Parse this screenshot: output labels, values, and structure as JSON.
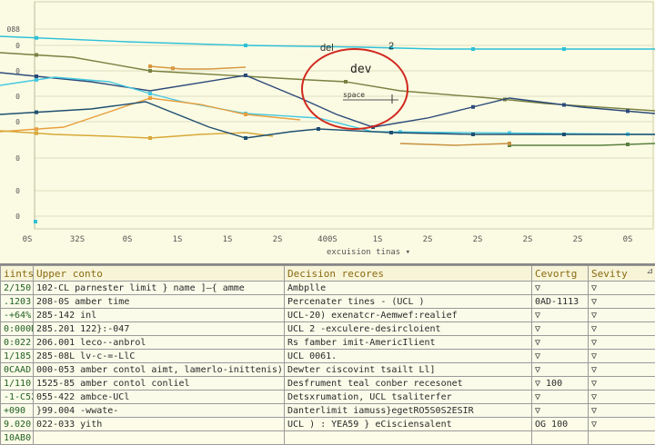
{
  "chart_data": {
    "type": "line",
    "y_tick_labels": [
      "088",
      "0",
      "0",
      "0",
      "0",
      "0",
      "0",
      "0"
    ],
    "y_tick_positions": [
      32,
      50,
      78,
      106,
      134,
      174,
      210,
      238
    ],
    "ylim": [
      0,
      300
    ],
    "x_tick_labels": [
      "0S",
      "32S",
      "0S",
      "1S",
      "1S",
      "2S",
      "400S",
      "1S",
      "2S",
      "2S",
      "2S",
      "2S",
      "0S"
    ],
    "xlabel": "excuision tinas",
    "series": [
      {
        "color": "#2ec0d8",
        "x": [
          0,
          140,
          270,
          400,
          480,
          560,
          620,
          720
        ],
        "y": [
          40,
          46,
          50,
          52,
          54,
          54,
          54,
          54
        ],
        "markers": [
          40,
          270,
          430,
          520,
          620
        ]
      },
      {
        "color": "#7a8040",
        "x": [
          0,
          80,
          165,
          270,
          340,
          380,
          440,
          540,
          600,
          720
        ],
        "y": [
          58,
          63,
          78,
          84,
          88,
          90,
          100,
          108,
          114,
          122
        ],
        "markers": [
          40,
          165,
          380,
          555
        ]
      },
      {
        "color": "#2c4a7a",
        "x": [
          0,
          100,
          165,
          270,
          330,
          370,
          410,
          470,
          560,
          640,
          720
        ],
        "y": [
          80,
          90,
          100,
          83,
          108,
          126,
          140,
          130,
          108,
          118,
          125
        ],
        "markers": [
          40,
          270,
          410,
          520,
          620,
          690
        ]
      },
      {
        "color": "#46c8e0",
        "x": [
          0,
          60,
          120,
          165,
          200,
          270,
          350,
          410,
          720
        ],
        "y": [
          94,
          85,
          90,
          103,
          112,
          125,
          130,
          145,
          148
        ],
        "markers": [
          40,
          165,
          270,
          440,
          560,
          690
        ]
      },
      {
        "color": "#e8a040",
        "x": [
          0,
          70,
          165,
          220,
          270,
          330
        ],
        "y": [
          145,
          140,
          108,
          115,
          126,
          132
        ],
        "markers": [
          40,
          165,
          270
        ]
      },
      {
        "color": "#d8a838",
        "x": [
          0,
          60,
          120,
          165,
          220,
          270,
          300
        ],
        "y": [
          144,
          148,
          150,
          152,
          148,
          146,
          150
        ],
        "markers": [
          40,
          165
        ]
      },
      {
        "color": "#1f4f70",
        "x": [
          0,
          100,
          160,
          230,
          270,
          320,
          350,
          430,
          520,
          620,
          720
        ],
        "y": [
          126,
          120,
          112,
          140,
          152,
          145,
          142,
          146,
          148,
          148,
          148
        ],
        "markers": [
          40,
          270,
          350,
          430,
          520,
          620
        ]
      },
      {
        "color": "#5a8040",
        "x": [
          560,
          620,
          660,
          720
        ],
        "y": [
          160,
          160,
          160,
          158
        ],
        "markers": [
          560,
          690
        ]
      },
      {
        "color": "#d89840",
        "x": [
          165,
          200,
          230,
          270
        ],
        "y": [
          73,
          76,
          76,
          74
        ],
        "markers": [
          165,
          190
        ]
      },
      {
        "color": "#c89040",
        "x": [
          440,
          500,
          560
        ],
        "y": [
          158,
          160,
          158
        ],
        "markers": [
          560
        ]
      }
    ],
    "annotations": {
      "del": "del",
      "two": "2",
      "dev": "dev",
      "space": "space"
    }
  },
  "table": {
    "headers": [
      "iints",
      "Upper conto",
      "Decision recores",
      "Cevortg",
      "Sevity"
    ],
    "rows": [
      [
        "2/150",
        "102-CL  parnester limit } name ]—{ amme",
        "Ambplle",
        "▽",
        "▽"
      ],
      [
        ".1203",
        "208-0S  amber time",
        "Percenater tines - (UCL )",
        "0AD-1113",
        "▽"
      ],
      [
        "-+64%",
        "285-142  inl",
        "UCL-20) exenatcr-Aemwef:realief",
        "▽",
        "▽"
      ],
      [
        "0:000D",
        "285.201  122}:-047",
        "UCL 2 -exculere-desircloient",
        "▽",
        "▽"
      ],
      [
        "0:022",
        "206.001  leco--anbrol",
        "Rs famber imit-AmericIlient",
        "▽",
        "▽"
      ],
      [
        "1/185",
        "285-08L  lv-c-=-LlC",
        "UCL 0061.",
        "▽",
        "▽"
      ],
      [
        "0CAAD",
        "000-053  amber contol aimt, lamerlo-inittenis)",
        "Dewter ciscovint tsailt Ll]",
        "▽",
        "▽"
      ],
      [
        "1/110",
        "1525-85  amber contol conliel",
        "Desfrument teal conber recesonet",
        "▽   100",
        "▽"
      ],
      [
        "-1-C52",
        "055-422  ambce-UCl",
        "Detsxrumation, UCL tsaliterfer",
        "▽",
        "▽"
      ],
      [
        "+090",
        "}99.004  -wwate-",
        "Danterlimit iamuss}egetRO5S0S2ESIR",
        "▽",
        "▽"
      ],
      [
        "9.020",
        "022-033  yith",
        "UCL ) : YEA59 } eCisciensalent",
        "OG  100",
        "▽"
      ],
      [
        "10AB0",
        "",
        "",
        "",
        ""
      ]
    ],
    "resize_mark": "⊿"
  }
}
